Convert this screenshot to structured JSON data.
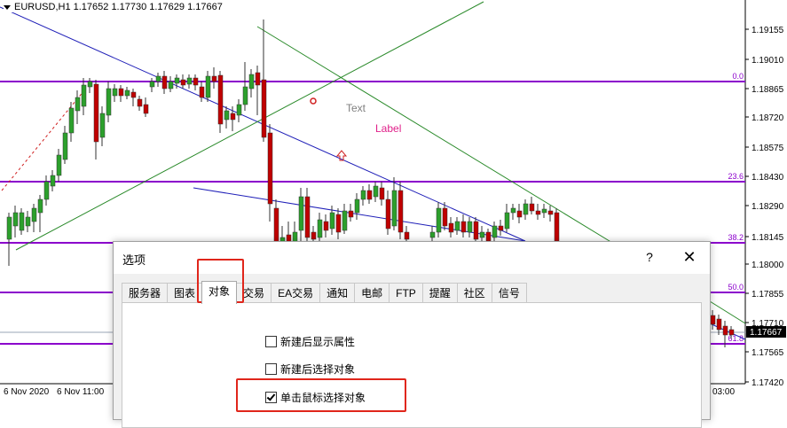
{
  "chart": {
    "symbol_line": "EURUSD,H1  1.17652 1.17730 1.17629 1.17667",
    "price_labels": [
      "1.19155",
      "1.19010",
      "1.18865",
      "1.18720",
      "1.18575",
      "1.18430",
      "1.18290",
      "1.18145",
      "1.18000",
      "1.17855",
      "1.17710",
      "1.17565",
      "1.17420"
    ],
    "current_price": "1.17667",
    "fib_labels": [
      "0.0",
      "23.6",
      "38.2",
      "50.0",
      "61.8"
    ],
    "time_labels": [
      "6 Nov 2020",
      "6 Nov 11:00",
      "03:00"
    ],
    "text_object": "Text",
    "label_object": "Label",
    "colors": {
      "fib": "#8b00cc",
      "trend_blue": "#1f1fb8",
      "trend_green": "#2a8a2a",
      "candle_bull": "#2ca02c",
      "candle_bear": "#c00000",
      "label": "#e0208a",
      "text": "#808080"
    }
  },
  "dialog": {
    "title": "选项",
    "help": "?",
    "close": "✕",
    "tabs": [
      "服务器",
      "图表",
      "对象",
      "交易",
      "EA交易",
      "通知",
      "电邮",
      "FTP",
      "提醒",
      "社区",
      "信号"
    ],
    "active_tab": "对象",
    "options": [
      {
        "label": "新建后显示属性",
        "checked": false
      },
      {
        "label": "新建后选择对象",
        "checked": false
      },
      {
        "label": "单击鼠标选择对象",
        "checked": true
      }
    ]
  }
}
